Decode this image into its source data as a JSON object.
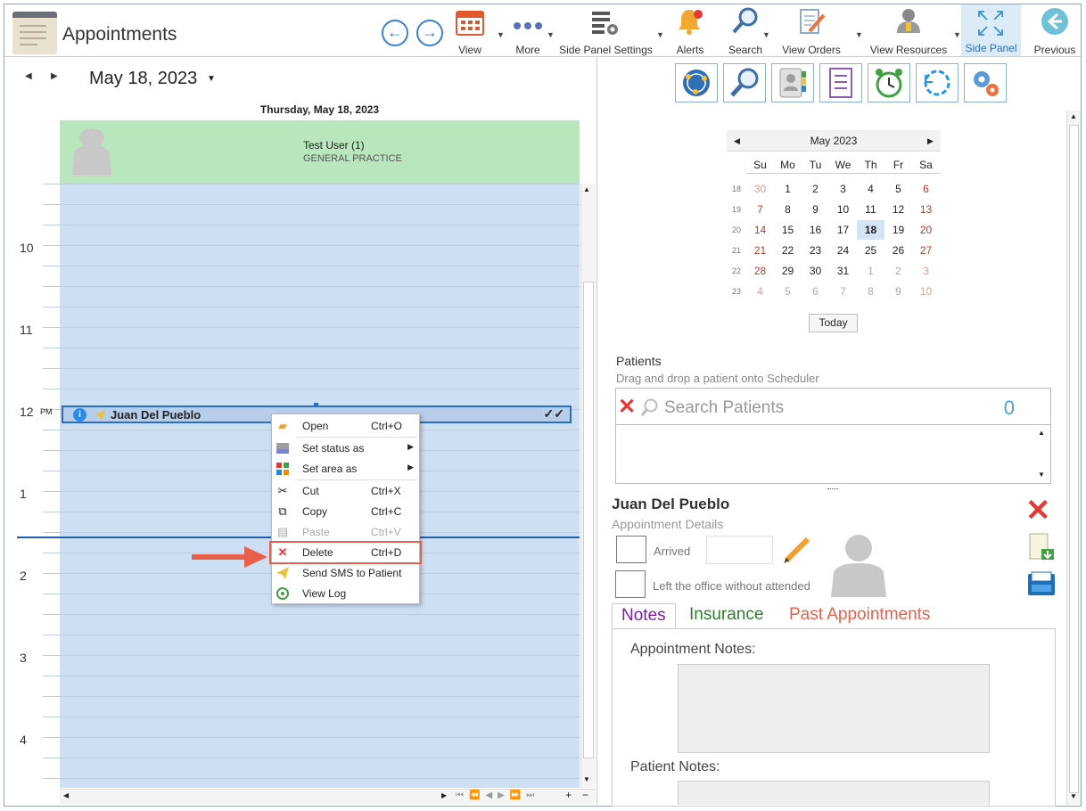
{
  "app": {
    "title": "Appointments"
  },
  "toolbar": {
    "buttons": [
      {
        "label": "View"
      },
      {
        "label": "More"
      },
      {
        "label": "Side Panel Settings"
      },
      {
        "label": "Alerts"
      },
      {
        "label": "Search"
      },
      {
        "label": "View Orders"
      },
      {
        "label": "View Resources"
      },
      {
        "label": "Side Panel"
      },
      {
        "label": "Previous"
      }
    ]
  },
  "scheduler": {
    "date": "May 18, 2023",
    "day_header": "Thursday, May 18, 2023",
    "resource": {
      "name": "Test User (1)",
      "department": "GENERAL PRACTICE"
    },
    "hours": [
      "10",
      "11",
      "12",
      "PM",
      "1",
      "2",
      "3",
      "4"
    ],
    "appointment": {
      "patient": "Juan Del Pueblo",
      "status_icon": "info-icon",
      "marks": "✓✓"
    }
  },
  "context_menu": {
    "items": [
      {
        "label": "Open",
        "shortcut": "Ctrl+O",
        "icon": "folder-icon"
      },
      {
        "label": "Set status as",
        "shortcut": "",
        "icon": "status-icon"
      },
      {
        "label": "Set area as",
        "shortcut": "",
        "icon": "area-icon"
      },
      {
        "label": "Cut",
        "shortcut": "Ctrl+X",
        "icon": "scissors-icon"
      },
      {
        "label": "Copy",
        "shortcut": "Ctrl+C",
        "icon": "copy-icon"
      },
      {
        "label": "Paste",
        "shortcut": "Ctrl+V",
        "icon": "paste-icon",
        "disabled": true
      },
      {
        "label": "Delete",
        "shortcut": "Ctrl+D",
        "icon": "x-icon"
      },
      {
        "label": "Send SMS to Patient",
        "shortcut": "",
        "icon": "send-icon"
      },
      {
        "label": "View Log",
        "shortcut": "",
        "icon": "log-icon"
      }
    ]
  },
  "mini_calendar": {
    "month": "May 2023",
    "weekdays": [
      "Su",
      "Mo",
      "Tu",
      "We",
      "Th",
      "Fr",
      "Sa"
    ],
    "weeks": [
      {
        "wk": "18",
        "days": [
          "30",
          "1",
          "2",
          "3",
          "4",
          "5",
          "6"
        ]
      },
      {
        "wk": "19",
        "days": [
          "7",
          "8",
          "9",
          "10",
          "11",
          "12",
          "13"
        ]
      },
      {
        "wk": "20",
        "days": [
          "14",
          "15",
          "16",
          "17",
          "18",
          "19",
          "20"
        ]
      },
      {
        "wk": "21",
        "days": [
          "21",
          "22",
          "23",
          "24",
          "25",
          "26",
          "27"
        ]
      },
      {
        "wk": "22",
        "days": [
          "28",
          "29",
          "30",
          "31",
          "1",
          "2",
          "3"
        ]
      },
      {
        "wk": "23",
        "days": [
          "4",
          "5",
          "6",
          "7",
          "8",
          "9",
          "10"
        ]
      }
    ],
    "selected": "18",
    "today_label": "Today"
  },
  "patients": {
    "title": "Patients",
    "hint": "Drag and drop a patient onto Scheduler",
    "search_placeholder": "Search Patients",
    "count": "0"
  },
  "details": {
    "patient_name": "Juan Del Pueblo",
    "subtitle": "Appointment Details",
    "arrived_label": "Arrived",
    "left_label": "Left the office without attended",
    "tabs": [
      "Notes",
      "Insurance",
      "Past Appointments"
    ],
    "appointment_notes_label": "Appointment Notes:",
    "patient_notes_label": "Patient Notes:"
  },
  "colors": {
    "accent": "#3a80d2",
    "resource_header": "#b9e6bc",
    "grid_bg": "#cddff3",
    "delete_red": "#e2604e",
    "tab_notes": "#7b1fa2",
    "tab_insurance": "#2e7d32",
    "tab_past": "#e8604c"
  }
}
